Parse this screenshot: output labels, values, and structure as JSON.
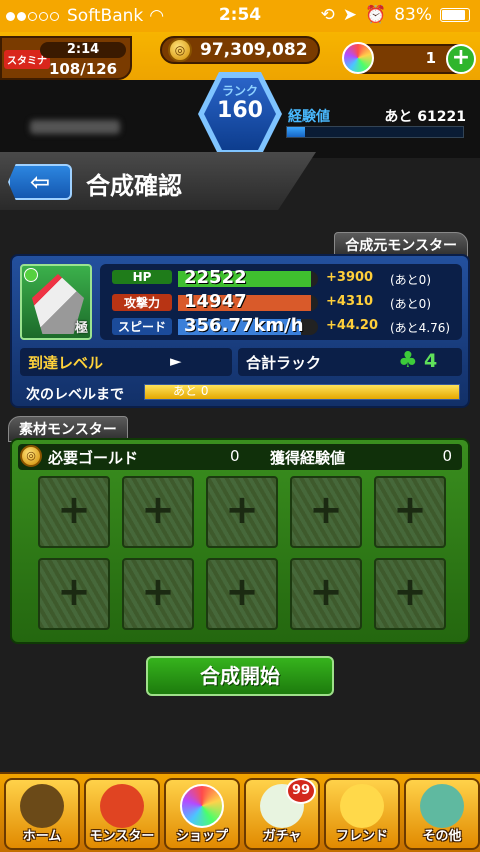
{
  "status_bar": {
    "carrier": "SoftBank",
    "time": "2:54",
    "battery": "83%"
  },
  "hud": {
    "stamina_tag": "スタミナ",
    "stamina_timer": "2:14",
    "stamina_count": "108/126",
    "gold": "97,309,082",
    "orbs": "1",
    "rank_label": "ランク",
    "rank": "160",
    "exp_label": "経験値",
    "exp_remaining": "あと 61221",
    "exp_progress": 0.1
  },
  "header": {
    "back_label": "⇦",
    "title": "合成確認"
  },
  "base_monster": {
    "section_title": "合成元モンスター",
    "rarity": "極",
    "stats": [
      {
        "name": "HP",
        "value": "22522",
        "bonus": "+3900",
        "remain": "(あと0)",
        "fill": 0.95,
        "color": "#3fbf2f",
        "tag_color": "#1f7c1a"
      },
      {
        "name": "攻撃力",
        "value": "14947",
        "bonus": "+4310",
        "remain": "(あと0)",
        "fill": 0.95,
        "color": "#d95a2a",
        "tag_color": "#b83414"
      },
      {
        "name": "スピード",
        "value": "356.77km/h",
        "bonus": "+44.20",
        "remain": "(あと4.76)",
        "fill": 0.88,
        "color": "#3a7fd9",
        "tag_color": "#1b4b9a"
      }
    ],
    "reach_label": "到達レベル",
    "reach_value": "►",
    "luck_label": "合計ラック",
    "luck_value": "4",
    "next_level_label": "次のレベルまで",
    "next_level_text": "あと 0",
    "next_level_progress": 1.0
  },
  "materials": {
    "section_title": "素材モンスター",
    "required_gold_label": "必要ゴールド",
    "required_gold": "0",
    "exp_gain_label": "獲得経験値",
    "exp_gain": "0",
    "slots": [
      "+",
      "+",
      "+",
      "+",
      "+",
      "+",
      "+",
      "+",
      "+",
      "+"
    ]
  },
  "start_button": "合成開始",
  "nav": [
    {
      "label": "ホーム",
      "icon": "home-icon",
      "color": "#6b4a18"
    },
    {
      "label": "モンスター",
      "icon": "monster-icon",
      "color": "#e04422"
    },
    {
      "label": "ショップ",
      "icon": "orb-icon",
      "color": "#9b6ce0"
    },
    {
      "label": "ガチャ",
      "icon": "egg-icon",
      "color": "#e8f4e0",
      "badge": "99"
    },
    {
      "label": "フレンド",
      "icon": "friends-icon",
      "color": "#ffd94a"
    },
    {
      "label": "その他",
      "icon": "other-icon",
      "color": "#5fb9a0"
    }
  ]
}
